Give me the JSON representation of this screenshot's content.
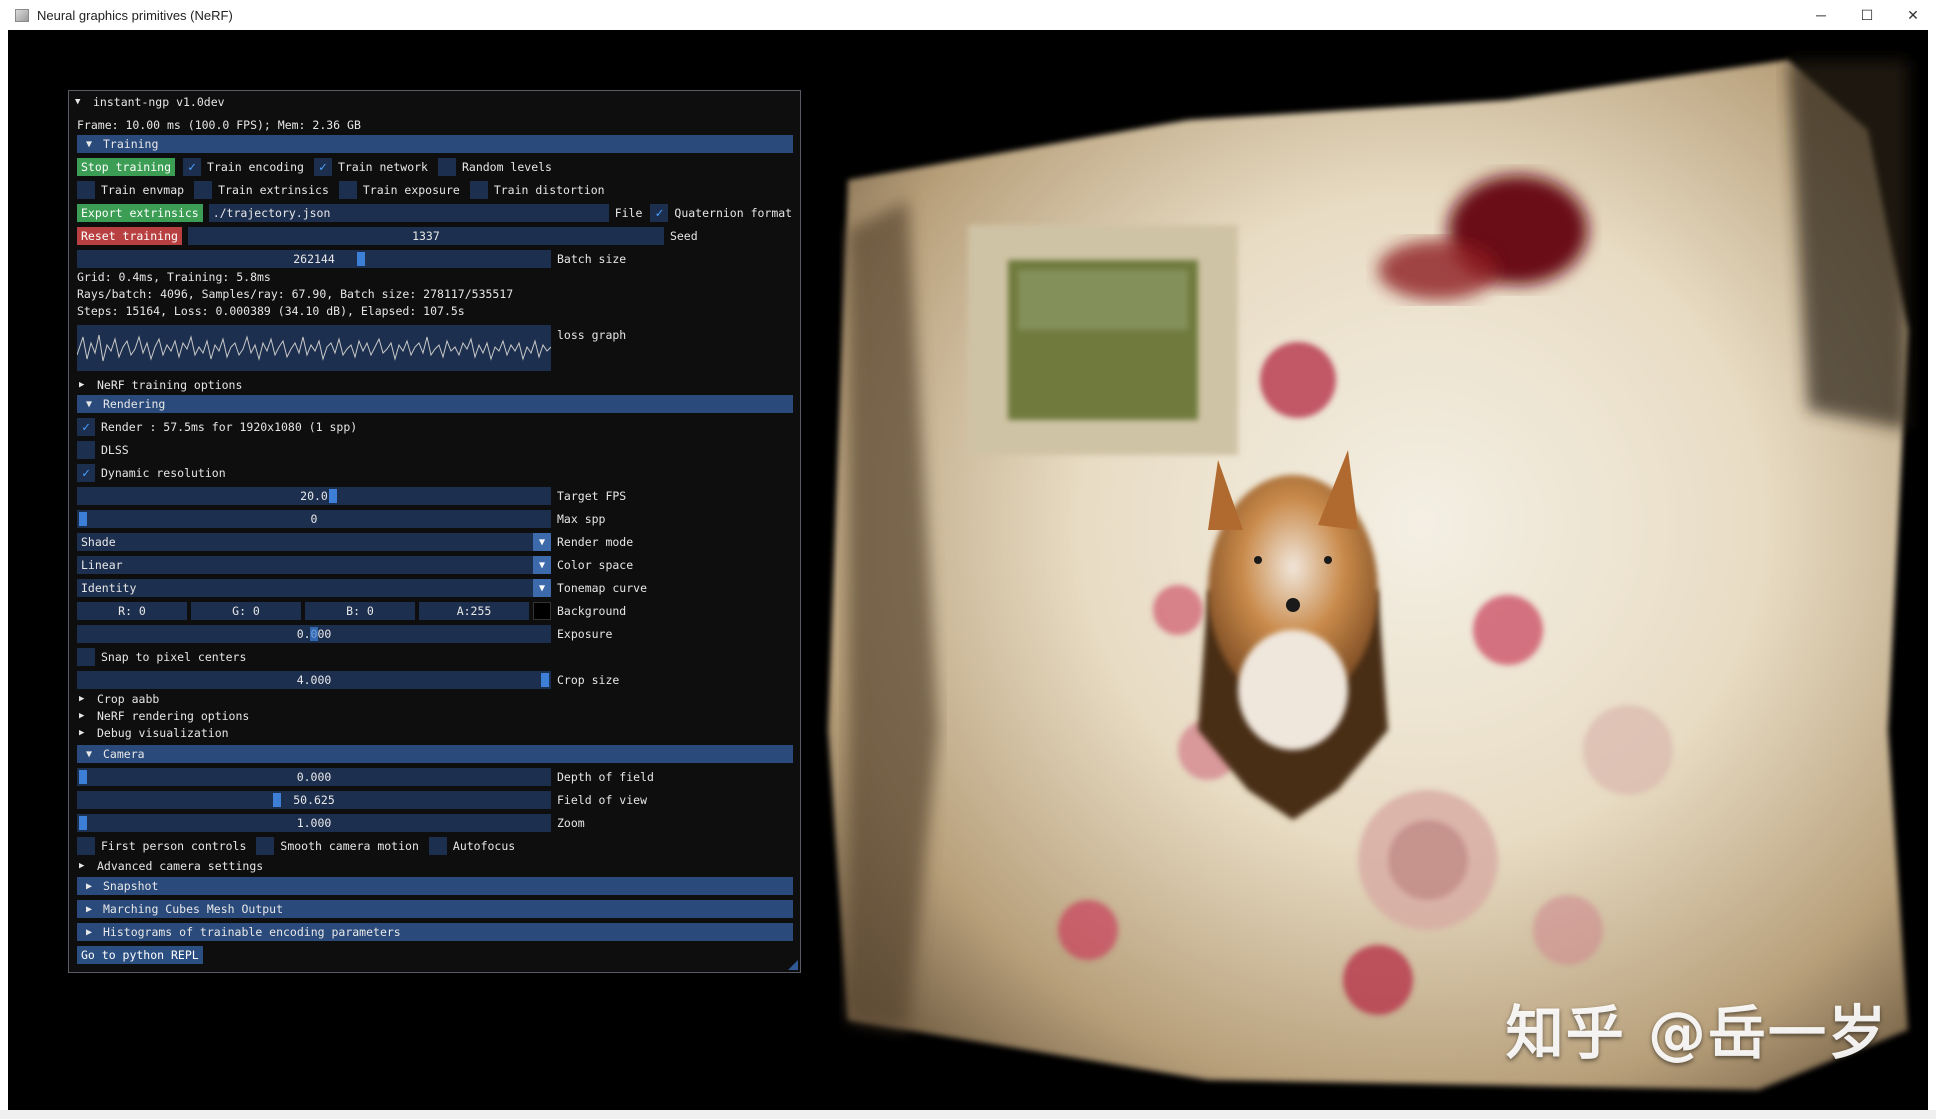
{
  "window": {
    "title": "Neural graphics primitives (NeRF)",
    "controls": [
      "─",
      "☐",
      "✕"
    ]
  },
  "panel": {
    "title": "instant-ngp v1.0dev",
    "frame_info": "Frame: 10.00 ms (100.0 FPS); Mem: 2.36 GB",
    "training": {
      "header": "Training",
      "stop_button": "Stop training",
      "train_encoding": "Train encoding",
      "train_encoding_checked": true,
      "train_network": "Train network",
      "train_network_checked": true,
      "random_levels": "Random levels",
      "train_envmap": "Train envmap",
      "train_extrinsics": "Train extrinsics",
      "train_exposure": "Train exposure",
      "train_distortion": "Train distortion",
      "export_button": "Export extrinsics",
      "file_value": "./trajectory.json",
      "file_label": "File",
      "quaternion_label": "Quaternion format",
      "quaternion_checked": true,
      "reset_button": "Reset training",
      "seed_value": "1337",
      "seed_label": "Seed",
      "batch_value": "262144",
      "batch_label": "Batch size",
      "batch_fraction": 0.6,
      "stats_line1": "Grid: 0.4ms, Training: 5.8ms",
      "stats_line2": "Rays/batch: 4096, Samples/ray: 67.90, Batch size: 278117/535517",
      "stats_line3": "Steps: 15164, Loss: 0.000389 (34.10 dB), Elapsed: 107.5s",
      "loss_label": "loss graph",
      "nerf_training_options": "NeRF training options"
    },
    "rendering": {
      "header": "Rendering",
      "render_label": "Render : 57.5ms for 1920x1080 (1 spp)",
      "render_checked": true,
      "dlss": "DLSS",
      "dynamic_resolution": "Dynamic resolution",
      "dynamic_checked": true,
      "target_fps_value": "20.0",
      "target_fps_label": "Target FPS",
      "max_spp_value": "0",
      "max_spp_label": "Max spp",
      "render_mode_value": "Shade",
      "render_mode_label": "Render mode",
      "color_space_value": "Linear",
      "color_space_label": "Color space",
      "tonemap_value": "Identity",
      "tonemap_label": "Tonemap curve",
      "bg_r": "R:  0",
      "bg_g": "G:  0",
      "bg_b": "B:  0",
      "bg_a": "A:255",
      "background_label": "Background",
      "exposure_value": "0.000",
      "exposure_label": "Exposure",
      "snap_label": "Snap to pixel centers",
      "crop_value": "4.000",
      "crop_label": "Crop size",
      "crop_aabb": "Crop aabb",
      "nerf_rendering_options": "NeRF rendering options",
      "debug_visualization": "Debug visualization"
    },
    "camera": {
      "header": "Camera",
      "dof_value": "0.000",
      "dof_label": "Depth of field",
      "fov_value": "50.625",
      "fov_label": "Field of view",
      "zoom_value": "1.000",
      "zoom_label": "Zoom",
      "first_person": "First person controls",
      "smooth_motion": "Smooth camera motion",
      "autofocus": "Autofocus",
      "advanced": "Advanced camera settings"
    },
    "snapshot_header": "Snapshot",
    "marching_header": "Marching Cubes Mesh Output",
    "histograms_header": "Histograms of trainable encoding parameters",
    "python_button": "Go to python REPL"
  },
  "watermark": "知乎 @岳一岁",
  "colors": {
    "header_bg": "#294a7a",
    "field_bg": "#1d2f4e",
    "grab": "#3d7fd6",
    "green_button": "#3b9e54",
    "red_button": "#b94040"
  }
}
